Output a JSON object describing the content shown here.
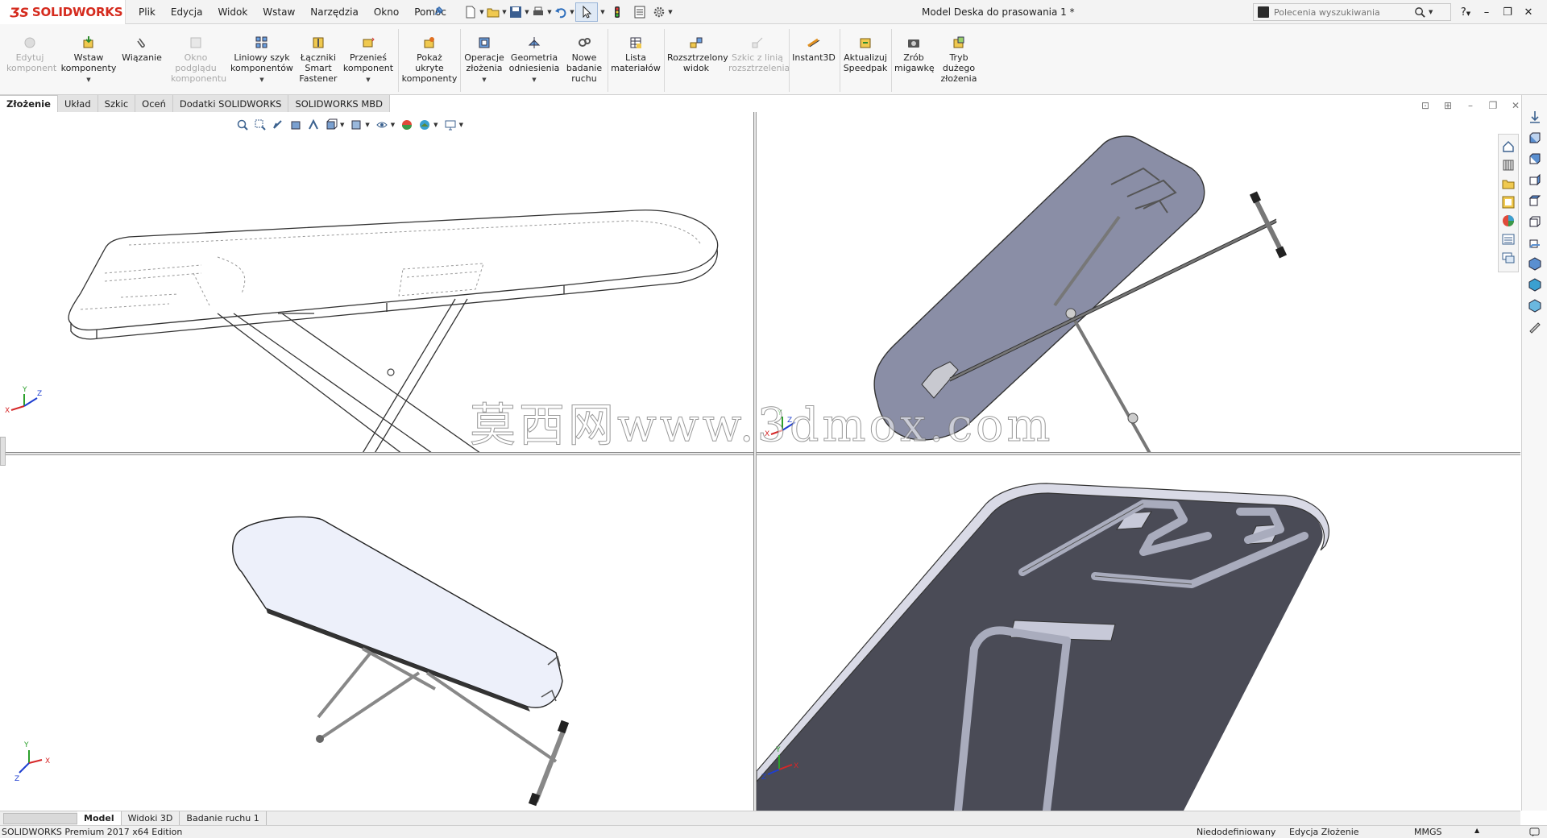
{
  "app": {
    "brand_ds": "ƷS",
    "brand_name_1": "SOLID",
    "brand_name_2": "WORKS",
    "document_title": "Model Deska do prasowania 1 *"
  },
  "menu": [
    "Plik",
    "Edycja",
    "Widok",
    "Wstaw",
    "Narzędzia",
    "Okno",
    "Pomoc"
  ],
  "search": {
    "placeholder": "Polecenia wyszukiwania"
  },
  "ribbon": {
    "edit_component": "Edytuj komponent",
    "insert_components": "Wstaw komponenty",
    "mate": "Wiązanie",
    "preview_window": "Okno podglądu komponentu",
    "linear_pattern": "Liniowy szyk komponentów",
    "smart_fasteners": "Łączniki Smart Fastener",
    "move_component": "Przenieś komponent",
    "show_hidden": "Pokaż ukryte komponenty",
    "assembly_features": "Operacje złożenia",
    "reference_geometry": "Geometria odniesienia",
    "new_motion_study": "Nowe badanie ruchu",
    "bill_of_materials": "Lista materiałów",
    "exploded_view": "Rozsztrzelony widok",
    "explode_line_sketch": "Szkic z linią rozsztrzelenia",
    "instant3d": "Instant3D",
    "update_speedpak": "Aktualizuj Speedpak",
    "take_snapshot": "Zrób migawkę",
    "large_assembly_mode": "Tryb dużego złożenia"
  },
  "tabs": [
    "Złożenie",
    "Układ",
    "Szkic",
    "Oceń",
    "Dodatki SOLIDWORKS",
    "SOLIDWORKS MBD"
  ],
  "bottom_tabs": [
    "Model",
    "Widoki 3D",
    "Badanie ruchu 1"
  ],
  "status": {
    "edition": "SOLIDWORKS Premium 2017 x64 Edition",
    "definition": "Niedodefiniowany",
    "mode": "Edycja Złożenie",
    "units": "MMGS"
  },
  "watermark": "莫西网www.3dmox.com",
  "triad": {
    "x": "X",
    "y": "Y",
    "z": "Z"
  },
  "colors": {
    "brand": "#d52b1e",
    "board_top": "#8a8ea6",
    "board_bottom": "#4a4b56",
    "board_light": "#edf0fa",
    "frame": "#a9acbd"
  }
}
